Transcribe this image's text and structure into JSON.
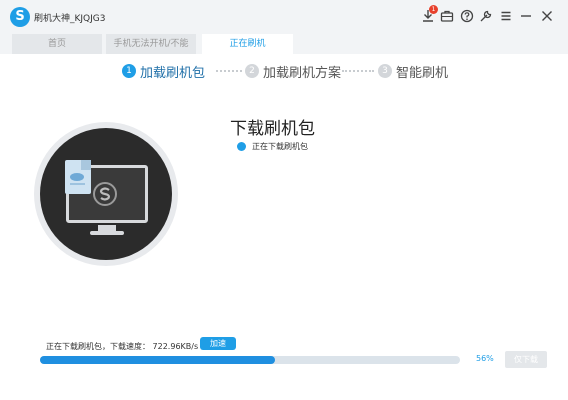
{
  "app": {
    "logo_glyph": "S",
    "title": "刷机大神_KJQJG3"
  },
  "toolbar": {
    "icons": [
      "download-icon",
      "briefcase-icon",
      "help-icon",
      "tools-icon",
      "menu-icon",
      "minimize-icon",
      "close-icon"
    ],
    "download_badge": "1"
  },
  "tabs": [
    {
      "label": "首页",
      "state": "inactive"
    },
    {
      "label": "手机无法开机/不能",
      "state": "inactive"
    },
    {
      "label": "正在刷机",
      "state": "active"
    }
  ],
  "steps": [
    {
      "number": "1",
      "label": "加载刷机包",
      "state": "active"
    },
    {
      "number": "2",
      "label": "加载刷机方案",
      "state": "pending"
    },
    {
      "number": "3",
      "label": "智能刷机",
      "state": "pending"
    }
  ],
  "main": {
    "heading": "下载刷机包",
    "status": "正在下载刷机包"
  },
  "download": {
    "label": "正在下载刷机包，下载速度： 722.96KB/s",
    "speedup_button": "加速",
    "progress": 0.56,
    "percent_text": "56%",
    "only_download_button": "仅下载"
  },
  "colors": {
    "accent": "#1f9ee6",
    "progress_fill": "#1f8fe0",
    "badge": "#e8412d"
  }
}
